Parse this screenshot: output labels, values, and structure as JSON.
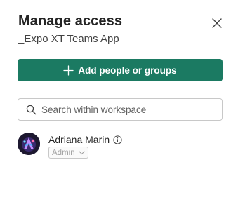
{
  "panel": {
    "title": "Manage access",
    "subtitle": "_Expo XT Teams App"
  },
  "actions": {
    "add_label": "Add people or groups",
    "accent_color": "#1b7a62"
  },
  "search": {
    "placeholder": "Search within workspace",
    "value": ""
  },
  "members": [
    {
      "name": "Adriana Marin",
      "role": "Admin",
      "avatar_icon": "avatar-illustration"
    }
  ],
  "icons": {
    "close": "close-icon",
    "add": "plus-icon",
    "search": "search-icon",
    "info": "info-icon",
    "dropdown": "chevron-down-icon"
  }
}
